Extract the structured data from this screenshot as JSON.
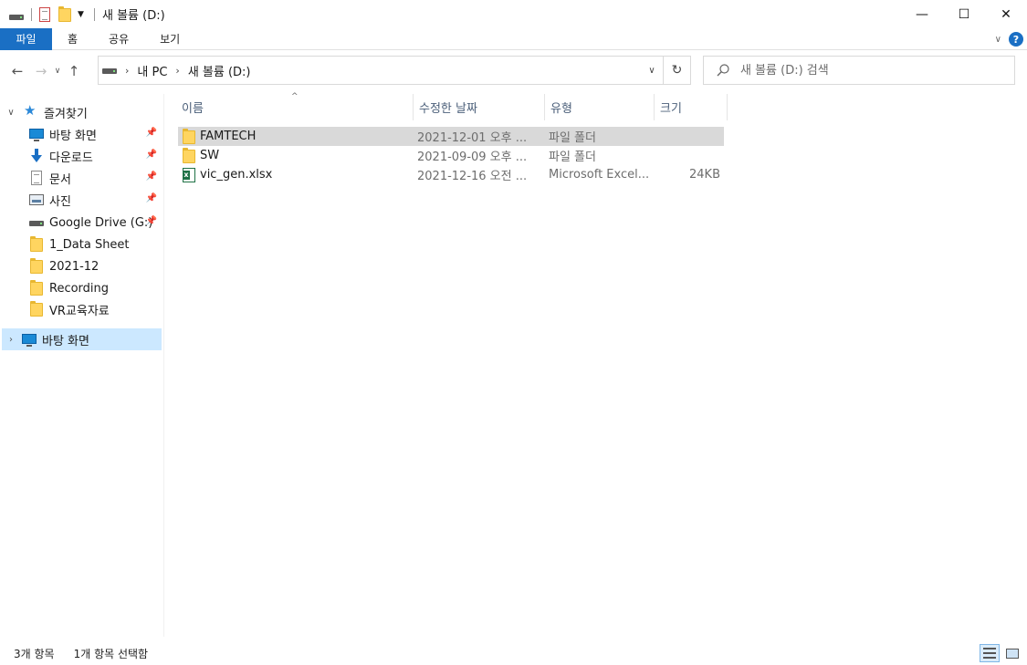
{
  "window": {
    "title": "새 볼륨 (D:)",
    "controls": {
      "minimize": "—",
      "maximize": "☐",
      "close": "✕"
    }
  },
  "ribbon": {
    "tabs": [
      {
        "label": "파일"
      },
      {
        "label": "홈"
      },
      {
        "label": "공유"
      },
      {
        "label": "보기"
      }
    ],
    "help": "?"
  },
  "address": {
    "crumbs": [
      "내 PC",
      "새 볼륨 (D:)"
    ],
    "search_placeholder": "새 볼륨 (D:) 검색"
  },
  "nav": {
    "quick_access": "즐겨찾기",
    "items": [
      {
        "label": "바탕 화면",
        "icon": "desktop-icon",
        "pinned": true
      },
      {
        "label": "다운로드",
        "icon": "download-icon",
        "pinned": true
      },
      {
        "label": "문서",
        "icon": "document-icon",
        "pinned": true
      },
      {
        "label": "사진",
        "icon": "pictures-icon",
        "pinned": true
      },
      {
        "label": "Google Drive (G:)",
        "icon": "drive-icon",
        "pinned": true
      },
      {
        "label": "1_Data Sheet",
        "icon": "folder-icon",
        "pinned": false
      },
      {
        "label": "2021-12",
        "icon": "folder-icon",
        "pinned": false
      },
      {
        "label": "Recording",
        "icon": "folder-icon",
        "pinned": false
      },
      {
        "label": "VR교육자료",
        "icon": "folder-icon",
        "pinned": false
      }
    ],
    "desktop_root": "바탕 화면"
  },
  "columns": {
    "name": "이름",
    "modified": "수정한 날짜",
    "type": "유형",
    "size": "크기"
  },
  "files": [
    {
      "name": "FAMTECH",
      "modified": "2021-12-01 오후 ...",
      "type": "파일 폴더",
      "size": "",
      "icon": "folder-icon",
      "selected": true
    },
    {
      "name": "SW",
      "modified": "2021-09-09 오후 ...",
      "type": "파일 폴더",
      "size": "",
      "icon": "folder-icon",
      "selected": false
    },
    {
      "name": "vic_gen.xlsx",
      "modified": "2021-12-16 오전 ...",
      "type": "Microsoft Excel...",
      "size": "24KB",
      "icon": "excel-icon",
      "selected": false
    }
  ],
  "status": {
    "item_count": "3개 항목",
    "selected_count": "1개 항목 선택함"
  },
  "colors": {
    "accent": "#1a6fc4",
    "selection": "#cce8ff",
    "row_selected": "#d9d9d9"
  }
}
